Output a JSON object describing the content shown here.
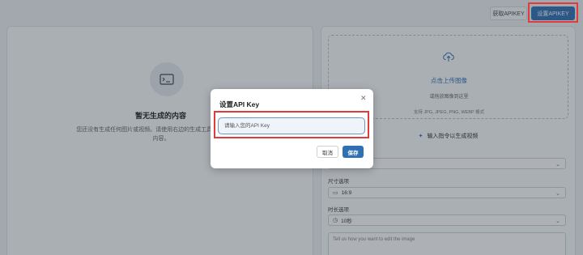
{
  "header": {
    "get_apikey_label": "获取APIKEY",
    "set_apikey_label": "设置APIKEY"
  },
  "empty_state": {
    "icon": "image-icon",
    "title": "暂无生成的内容",
    "description": "您还没有生成任何图片或视频。请使用右边的生成工具创建第一个AI内容。"
  },
  "upload": {
    "icon": "upload-cloud-icon",
    "title": "点击上传图像",
    "subtitle": "或拖放图像到这里",
    "formats": "支持 JPG, JPEG, PNG, WEBP 格式"
  },
  "prompt_heading": {
    "icon": "sparkle-icon",
    "label": "输入指令以生成视频"
  },
  "options": {
    "size_label": "尺寸选项",
    "size_value": "16:9",
    "duration_label": "时长选项",
    "duration_value": "10秒"
  },
  "prompt_input": {
    "placeholder": "Tell us how you want to edit the image"
  },
  "modal": {
    "title": "设置API Key",
    "input_placeholder": "请输入您的API Key",
    "cancel_label": "取消",
    "save_label": "保存"
  },
  "colors": {
    "accent": "#2f6fb4",
    "highlight": "#e23b3b"
  }
}
